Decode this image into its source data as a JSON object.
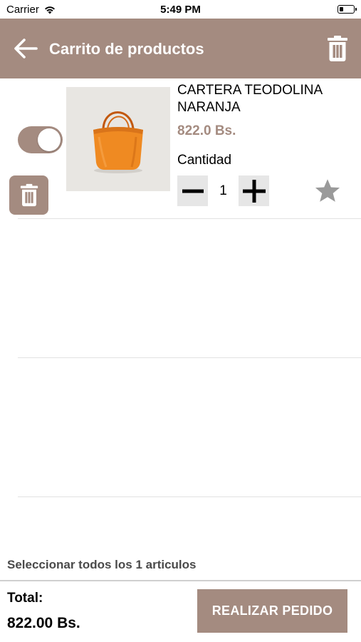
{
  "status_bar": {
    "carrier": "Carrier",
    "time": "5:49 PM",
    "battery_level": 0.3
  },
  "header": {
    "title": "Carrito de productos",
    "background_color": "#a48b80",
    "back_icon": "arrow-left-icon",
    "delete_icon": "trash-icon"
  },
  "cart": {
    "items": [
      {
        "selected": true,
        "name": "CARTERA TEODOLINA NARANJA",
        "price": "822.0 Bs.",
        "quantity_label": "Cantidad",
        "quantity": "1",
        "favorite": false
      }
    ]
  },
  "footer": {
    "select_all_label": "Seleccionar todos los 1 articulos",
    "total_label": "Total:",
    "total_value": "822.00 Bs.",
    "order_button_label": "REALIZAR PEDIDO"
  }
}
